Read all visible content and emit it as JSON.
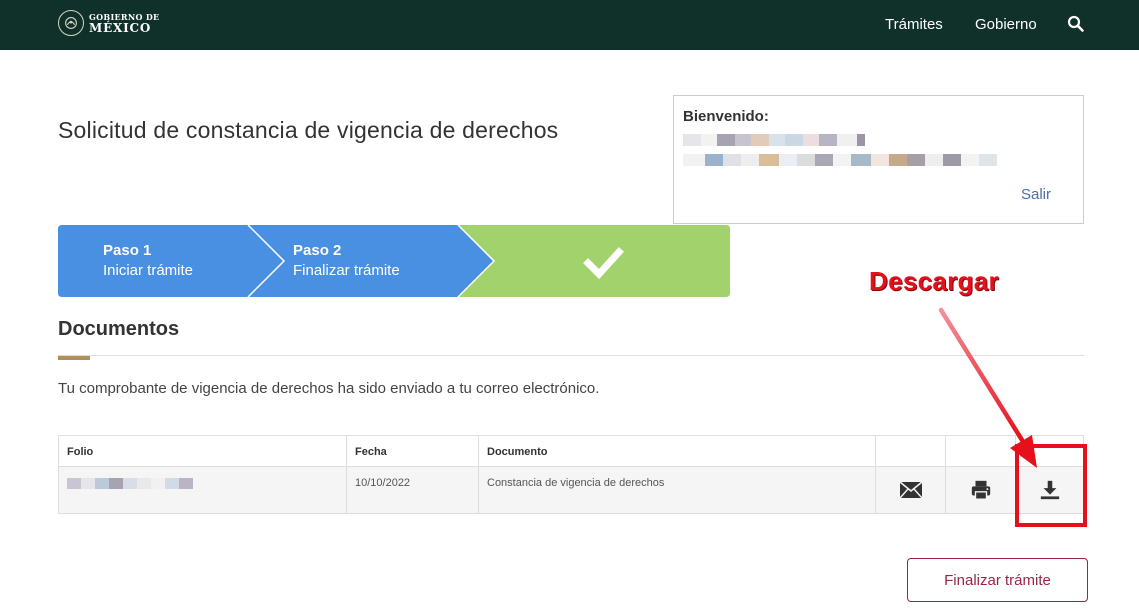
{
  "header": {
    "logo_line1": "GOBIERNO DE",
    "logo_line2": "MÉXICO",
    "nav": [
      {
        "label": "Trámites"
      },
      {
        "label": "Gobierno"
      }
    ],
    "search_icon": "search-icon",
    "background_color": "#10302a"
  },
  "page": {
    "title": "Solicitud de constancia de vigencia de derechos"
  },
  "welcome": {
    "label": "Bienvenido:",
    "logout": "Salir"
  },
  "stepper": {
    "steps": [
      {
        "title": "Paso 1",
        "subtitle": "Iniciar trámite",
        "color": "#4a90e2"
      },
      {
        "title": "Paso 2",
        "subtitle": "Finalizar trámite",
        "color": "#4a90e2"
      },
      {
        "icon": "checkmark-icon",
        "color": "#a1d26c"
      }
    ]
  },
  "documents": {
    "section_title": "Documentos",
    "description": "Tu comprobante de vigencia de derechos ha sido enviado a tu correo electrónico.",
    "columns": [
      "Folio",
      "Fecha",
      "Documento",
      "",
      "",
      ""
    ],
    "rows": [
      {
        "folio": "",
        "fecha": "10/10/2022",
        "documento": "Constancia de vigencia de derechos",
        "actions": [
          "envelope-icon",
          "printer-icon",
          "download-icon"
        ]
      }
    ]
  },
  "annotation": {
    "label": "Descargar",
    "color": "#e5101b"
  },
  "footer": {
    "finish_button": "Finalizar trámite",
    "accent_color": "#9d2449"
  }
}
